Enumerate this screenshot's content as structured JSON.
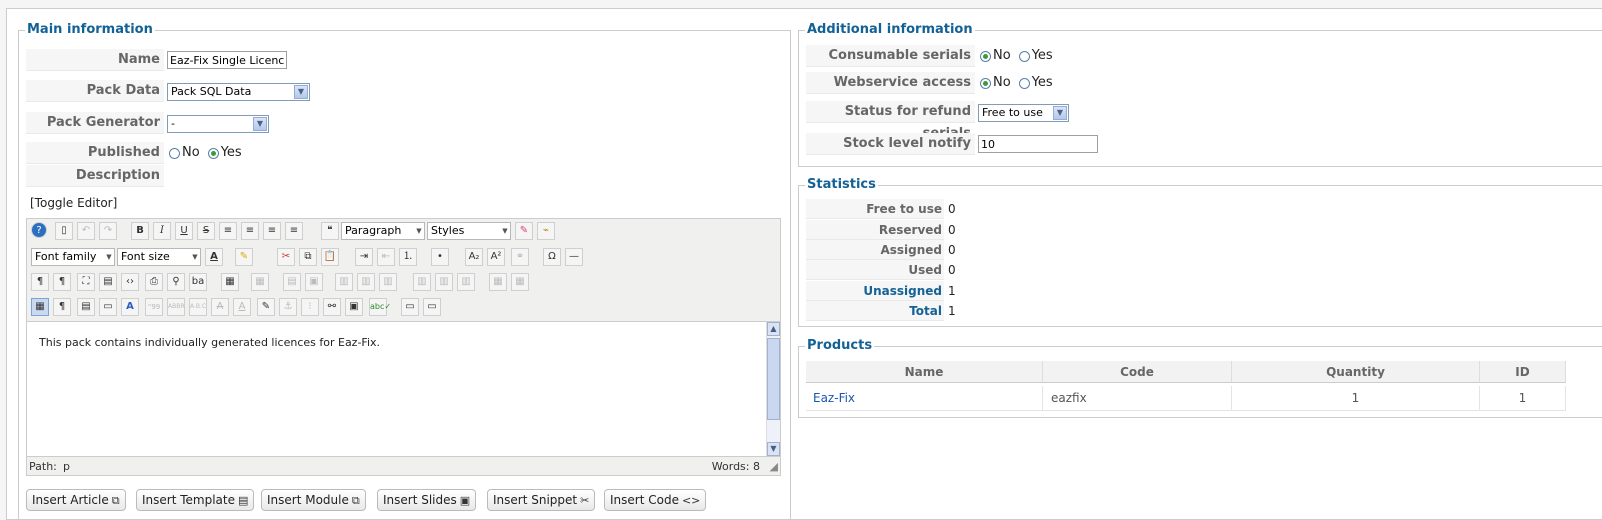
{
  "main": {
    "legend": "Main information",
    "name_label": "Name",
    "name_value": "Eaz-Fix Single Licenc",
    "pack_data_label": "Pack Data",
    "pack_data_value": "Pack SQL Data",
    "pack_generator_label": "Pack Generator",
    "pack_generator_value": "-",
    "published_label": "Published",
    "published_no": "No",
    "published_yes": "Yes",
    "published_selected": "Yes",
    "description_label": "Description",
    "toggle_editor": "[Toggle Editor]"
  },
  "editor": {
    "paragraph": "Paragraph",
    "styles": "Styles",
    "font_family": "Font family",
    "font_size": "Font size",
    "content": "This pack contains individually generated licences for Eaz-Fix.",
    "path_label": "Path:",
    "path_value": "p",
    "words": "Words: 8",
    "icons": [
      "help-icon",
      "new-document-icon",
      "undo-icon",
      "redo-icon",
      "bold-icon",
      "italic-icon",
      "underline-icon",
      "strikethrough-icon",
      "align-justify-icon",
      "align-center-icon",
      "align-left-icon",
      "align-right-icon",
      "blockquote-icon",
      "eraser-icon",
      "cleanup-icon"
    ]
  },
  "insert_buttons": [
    {
      "label": "Insert Article",
      "icon": "article-icon"
    },
    {
      "label": "Insert Template",
      "icon": "template-icon"
    },
    {
      "label": "Insert Module",
      "icon": "module-icon"
    },
    {
      "label": "Insert Slides",
      "icon": "slides-icon"
    },
    {
      "label": "Insert Snippet",
      "icon": "snippet-icon"
    },
    {
      "label": "Insert Code",
      "icon": "code-icon"
    }
  ],
  "additional": {
    "legend": "Additional information",
    "consumable_label": "Consumable serials",
    "webservice_label": "Webservice access",
    "no": "No",
    "yes": "Yes",
    "consumable_selected": "No",
    "webservice_selected": "No",
    "refund_label": "Status for refund serials",
    "refund_value": "Free to use",
    "stock_label": "Stock level notify",
    "stock_value": "10"
  },
  "statistics": {
    "legend": "Statistics",
    "rows": [
      {
        "label": "Free to use",
        "value": "0"
      },
      {
        "label": "Reserved",
        "value": "0"
      },
      {
        "label": "Assigned",
        "value": "0"
      },
      {
        "label": "Used",
        "value": "0"
      },
      {
        "label": "Unassigned",
        "value": "1"
      },
      {
        "label": "Total",
        "value": "1"
      }
    ]
  },
  "products": {
    "legend": "Products",
    "columns": [
      "Name",
      "Code",
      "Quantity",
      "ID"
    ],
    "rows": [
      {
        "name": "Eaz-Fix",
        "code": "eazfix",
        "quantity": "1",
        "id": "1"
      }
    ]
  }
}
